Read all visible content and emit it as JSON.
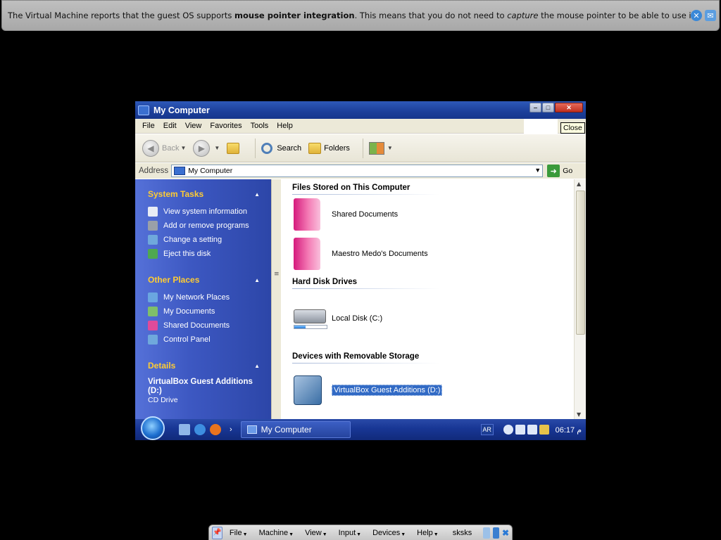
{
  "notification": {
    "text_prefix": "The Virtual Machine reports that the guest OS supports ",
    "text_bold": "mouse pointer integration",
    "text_mid": ". This means that you do not need to ",
    "text_italic": "capture",
    "text_suffix": " the mouse pointer to be able to use it in your guest OS -- all mouse"
  },
  "window": {
    "title": "My Computer",
    "tooltip": "Close"
  },
  "menubar": {
    "items": [
      "File",
      "Edit",
      "View",
      "Favorites",
      "Tools",
      "Help"
    ]
  },
  "toolbar": {
    "back_label": "Back",
    "search_label": "Search",
    "folders_label": "Folders"
  },
  "address": {
    "label": "Address",
    "value": "My Computer",
    "go_label": "Go"
  },
  "left_pane": {
    "system_tasks": {
      "title": "System Tasks",
      "items": [
        "View system information",
        "Add or remove programs",
        "Change a setting",
        "Eject this disk"
      ]
    },
    "other_places": {
      "title": "Other Places",
      "items": [
        "My Network Places",
        "My Documents",
        "Shared Documents",
        "Control Panel"
      ]
    },
    "details": {
      "title": "Details",
      "name": "VirtualBox Guest Additions (D:)",
      "subtitle": "CD Drive"
    }
  },
  "content": {
    "groups": [
      {
        "title": "Files Stored on This Computer",
        "items": [
          "Shared Documents",
          "Maestro Medo's Documents"
        ]
      },
      {
        "title": "Hard Disk Drives",
        "items": [
          "Local Disk (C:)"
        ]
      },
      {
        "title": "Devices with Removable Storage",
        "items": [
          "VirtualBox Guest Additions (D:)"
        ]
      }
    ],
    "local_disk_used_fraction": 0.35
  },
  "taskbar": {
    "task_label": "My Computer",
    "lang": "AR",
    "time": "06:17 م"
  },
  "minibar": {
    "items": [
      "File",
      "Machine",
      "View",
      "Input",
      "Devices",
      "Help"
    ],
    "vm_name": "sksks"
  },
  "colors": {
    "xp_title_blue": "#1c3f9a",
    "task_pane_blue": "#3d58c2",
    "task_heading": "#ffcc33",
    "selection": "#316ac5"
  }
}
